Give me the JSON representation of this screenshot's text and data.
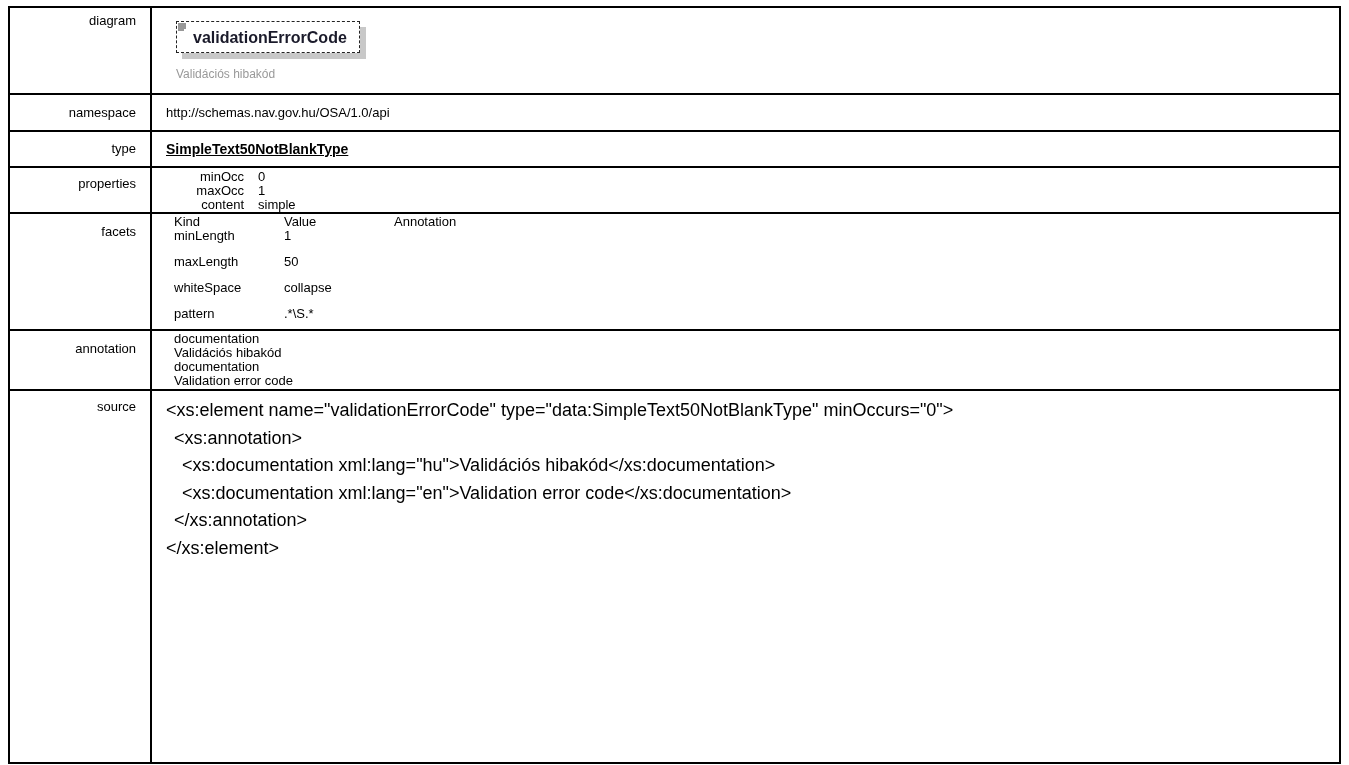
{
  "diagram": {
    "label": "diagram",
    "element": "validationErrorCode",
    "caption": "Validációs hibakód"
  },
  "namespace": {
    "label": "namespace",
    "value": "http://schemas.nav.gov.hu/OSA/1.0/api"
  },
  "type": {
    "label": "type",
    "value": "SimpleText50NotBlankType"
  },
  "properties": {
    "label": "properties",
    "items": [
      {
        "name": "minOcc",
        "value": "0"
      },
      {
        "name": "maxOcc",
        "value": "1"
      },
      {
        "name": "content",
        "value": "simple"
      }
    ]
  },
  "facets": {
    "label": "facets",
    "columns": [
      "Kind",
      "Value",
      "Annotation"
    ],
    "rows": [
      {
        "kind": "minLength",
        "value": "1"
      },
      {
        "kind": "maxLength",
        "value": "50"
      },
      {
        "kind": "whiteSpace",
        "value": "collapse"
      },
      {
        "kind": "pattern",
        "value": ".*\\S.*"
      }
    ]
  },
  "annotation": {
    "label": "annotation",
    "lines": [
      "documentation",
      "Validációs hibakód",
      "documentation",
      "Validation error code"
    ]
  },
  "source": {
    "label": "source",
    "code": [
      {
        "text": "<xs:element name=\"validationErrorCode\" type=\"data:SimpleText50NotBlankType\" minOccurs=\"0\">",
        "children": [
          {
            "text": "<xs:annotation>",
            "children": [
              {
                "text": "<xs:documentation xml:lang=\"hu\">Validációs hibakód</xs:documentation>"
              },
              {
                "text": "<xs:documentation xml:lang=\"en\">Validation error code</xs:documentation>"
              }
            ]
          },
          {
            "text": "</xs:annotation>"
          }
        ]
      },
      {
        "text": "</xs:element>"
      }
    ]
  }
}
